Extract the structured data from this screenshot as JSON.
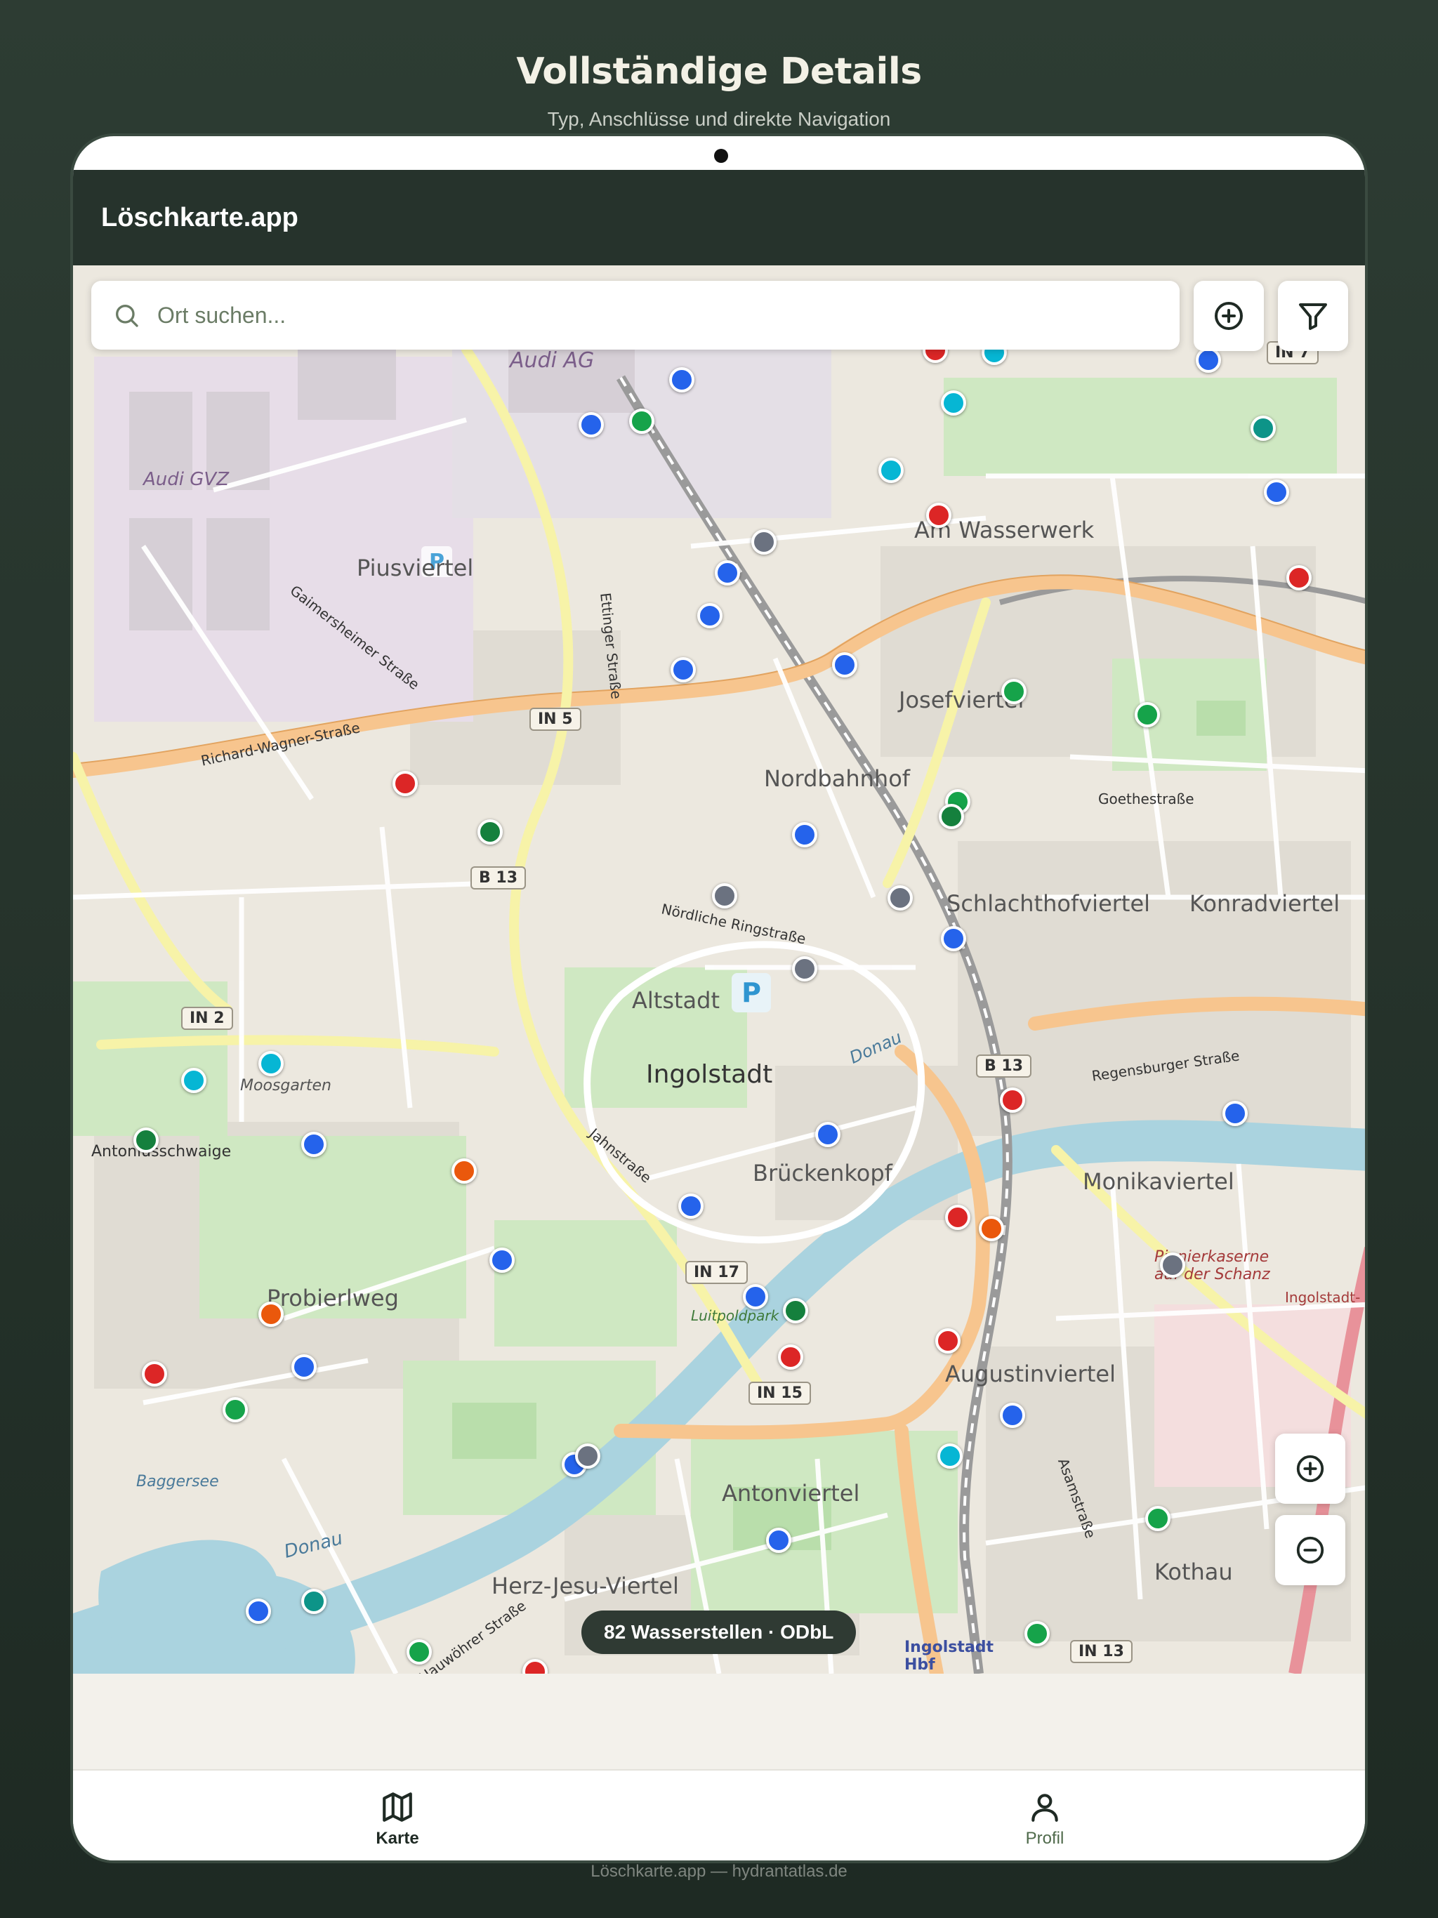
{
  "hero": {
    "title": "Vollständige Details",
    "subtitle": "Typ, Anschlüsse und direkte Navigation"
  },
  "app": {
    "title": "Löschkarte.app"
  },
  "search": {
    "placeholder": "Ort suchen..."
  },
  "map_labels": {
    "audi_ag": "Audi AG",
    "audi_gvz": "Audi GVZ",
    "piusviertel": "Piusviertel",
    "am_wasserwerk": "Am Wasserwerk",
    "josefviertel": "Josefviertel",
    "nordbahnhof": "Nordbahnhof",
    "schlachthofviertel": "Schlachthofviertel",
    "konradviertel": "Konradviertel",
    "altstadt": "Altstadt",
    "ingolstadt": "Ingolstadt",
    "brueckenkopf": "Brückenkopf",
    "monikaviertel": "Monikaviertel",
    "moosgarten": "Moosgarten",
    "antoniusschwaige": "Antoniusschwaige",
    "probierlweg": "Probierlweg",
    "augustinviertel": "Augustinviertel",
    "antonviertel": "Antonviertel",
    "herz_jesu_viertel": "Herz-Jesu-Viertel",
    "kothau": "Kothau",
    "baggersee": "Baggersee",
    "donau_river": "Donau",
    "donau_upper": "Donau",
    "luitpoldpark": "Luitpoldpark",
    "pionierkaserne": "Pionierkaserne auf der Schanz",
    "hbf": "Ingolstadt Hbf",
    "richard_wagner": "Richard-Wagner-Straße",
    "gaimersheimer": "Gaimersheimer Straße",
    "ettinger": "Ettinger Straße",
    "nordliche_ringstrasse": "Nördliche Ringstraße",
    "goethestrasse": "Goethestraße",
    "regensburger": "Regensburger Straße",
    "jahnstrasse": "Jahnstraße",
    "hauwoehrer": "Hauwöhrer Straße",
    "asamstrasse": "Asamstraße",
    "ingolstadt_nord": "Ingolstadt-",
    "roadB13a": "B 13",
    "roadB13b": "B 13",
    "roadIN5": "IN 5",
    "roadIN2": "IN 2",
    "roadIN17": "IN 17",
    "roadIN15": "IN 15",
    "roadIN13": "IN 13",
    "roadIN7": "IN 7"
  },
  "markers": [
    {
      "lon": 555,
      "lat": 308,
      "type": "blue"
    },
    {
      "lon": 481,
      "lat": 345,
      "type": "blue"
    },
    {
      "lon": 522,
      "lat": 342,
      "type": "green"
    },
    {
      "lon": 762,
      "lat": 284,
      "type": "red"
    },
    {
      "lon": 810,
      "lat": 286,
      "type": "cyan"
    },
    {
      "lon": 777,
      "lat": 327,
      "type": "cyan"
    },
    {
      "lon": 726,
      "lat": 382,
      "type": "cyan"
    },
    {
      "lon": 985,
      "lat": 292,
      "type": "blue"
    },
    {
      "lon": 1030,
      "lat": 348,
      "type": "teal"
    },
    {
      "lon": 1041,
      "lat": 400,
      "type": "blue"
    },
    {
      "lon": 765,
      "lat": 419,
      "type": "red"
    },
    {
      "lon": 1059,
      "lat": 470,
      "type": "red"
    },
    {
      "lon": 622,
      "lat": 441,
      "type": "gray"
    },
    {
      "lon": 592,
      "lat": 466,
      "type": "blue"
    },
    {
      "lon": 578,
      "lat": 501,
      "type": "blue"
    },
    {
      "lon": 556,
      "lat": 545,
      "type": "blue"
    },
    {
      "lon": 688,
      "lat": 541,
      "type": "blue"
    },
    {
      "lon": 826,
      "lat": 563,
      "type": "green"
    },
    {
      "lon": 935,
      "lat": 582,
      "type": "green"
    },
    {
      "lon": 329,
      "lat": 638,
      "type": "red"
    },
    {
      "lon": 398,
      "lat": 678,
      "type": "darkgreen"
    },
    {
      "lon": 780,
      "lat": 653,
      "type": "green"
    },
    {
      "lon": 775,
      "lat": 665,
      "type": "darkgreen"
    },
    {
      "lon": 655,
      "lat": 680,
      "type": "blue"
    },
    {
      "lon": 590,
      "lat": 730,
      "type": "gray"
    },
    {
      "lon": 733,
      "lat": 732,
      "type": "gray"
    },
    {
      "lon": 777,
      "lat": 765,
      "type": "blue"
    },
    {
      "lon": 655,
      "lat": 790,
      "type": "gray"
    },
    {
      "lon": 219,
      "lat": 867,
      "type": "cyan"
    },
    {
      "lon": 156,
      "lat": 881,
      "type": "cyan"
    },
    {
      "lon": 117,
      "lat": 930,
      "type": "darkgreen"
    },
    {
      "lon": 254,
      "lat": 933,
      "type": "blue"
    },
    {
      "lon": 825,
      "lat": 897,
      "type": "red"
    },
    {
      "lon": 1007,
      "lat": 908,
      "type": "blue"
    },
    {
      "lon": 674,
      "lat": 925,
      "type": "blue"
    },
    {
      "lon": 377,
      "lat": 955,
      "type": "orange"
    },
    {
      "lon": 562,
      "lat": 984,
      "type": "blue"
    },
    {
      "lon": 780,
      "lat": 993,
      "type": "red"
    },
    {
      "lon": 808,
      "lat": 1002,
      "type": "orange"
    },
    {
      "lon": 956,
      "lat": 1032,
      "type": "gray"
    },
    {
      "lon": 408,
      "lat": 1028,
      "type": "blue"
    },
    {
      "lon": 615,
      "lat": 1058,
      "type": "blue"
    },
    {
      "lon": 648,
      "lat": 1069,
      "type": "darkgreen"
    },
    {
      "lon": 219,
      "lat": 1072,
      "type": "orange"
    },
    {
      "lon": 644,
      "lat": 1107,
      "type": "red"
    },
    {
      "lon": 772,
      "lat": 1094,
      "type": "red"
    },
    {
      "lon": 246,
      "lat": 1115,
      "type": "blue"
    },
    {
      "lon": 124,
      "lat": 1121,
      "type": "red"
    },
    {
      "lon": 190,
      "lat": 1150,
      "type": "green"
    },
    {
      "lon": 825,
      "lat": 1155,
      "type": "blue"
    },
    {
      "lon": 774,
      "lat": 1188,
      "type": "cyan"
    },
    {
      "lon": 467,
      "lat": 1195,
      "type": "blue"
    },
    {
      "lon": 478,
      "lat": 1188,
      "type": "gray"
    },
    {
      "lon": 944,
      "lat": 1239,
      "type": "green"
    },
    {
      "lon": 634,
      "lat": 1257,
      "type": "blue"
    },
    {
      "lon": 209,
      "lat": 1315,
      "type": "blue"
    },
    {
      "lon": 254,
      "lat": 1307,
      "type": "teal"
    },
    {
      "lon": 340,
      "lat": 1348,
      "type": "green"
    },
    {
      "lon": 845,
      "lat": 1333,
      "type": "green"
    },
    {
      "lon": 435,
      "lat": 1364,
      "type": "red"
    }
  ],
  "marker_colors": {
    "blue": "#2563eb",
    "green": "#16a34a",
    "darkgreen": "#15803d",
    "red": "#dc2626",
    "cyan": "#06b6d4",
    "teal": "#0d9488",
    "gray": "#6b7280",
    "orange": "#ea580c"
  },
  "map_status": {
    "count_text": "82 Wasserstellen · ODbL"
  },
  "map_controls": {
    "add_icon": "plus-circle-icon",
    "filter_icon": "filter-icon",
    "zoom_in_icon": "zoom-in-icon",
    "zoom_out_icon": "zoom-out-icon"
  },
  "tabs": [
    {
      "label": "Karte",
      "icon": "map-icon",
      "active": true
    },
    {
      "label": "Profil",
      "icon": "user-icon",
      "active": false
    }
  ],
  "colors": {
    "header_bg": "#26332c",
    "tab_active": "#1f2a24",
    "tab_inactive": "#4f6a4b"
  },
  "footer": {
    "text": "Löschkarte.app — hydrantatlas.de"
  }
}
